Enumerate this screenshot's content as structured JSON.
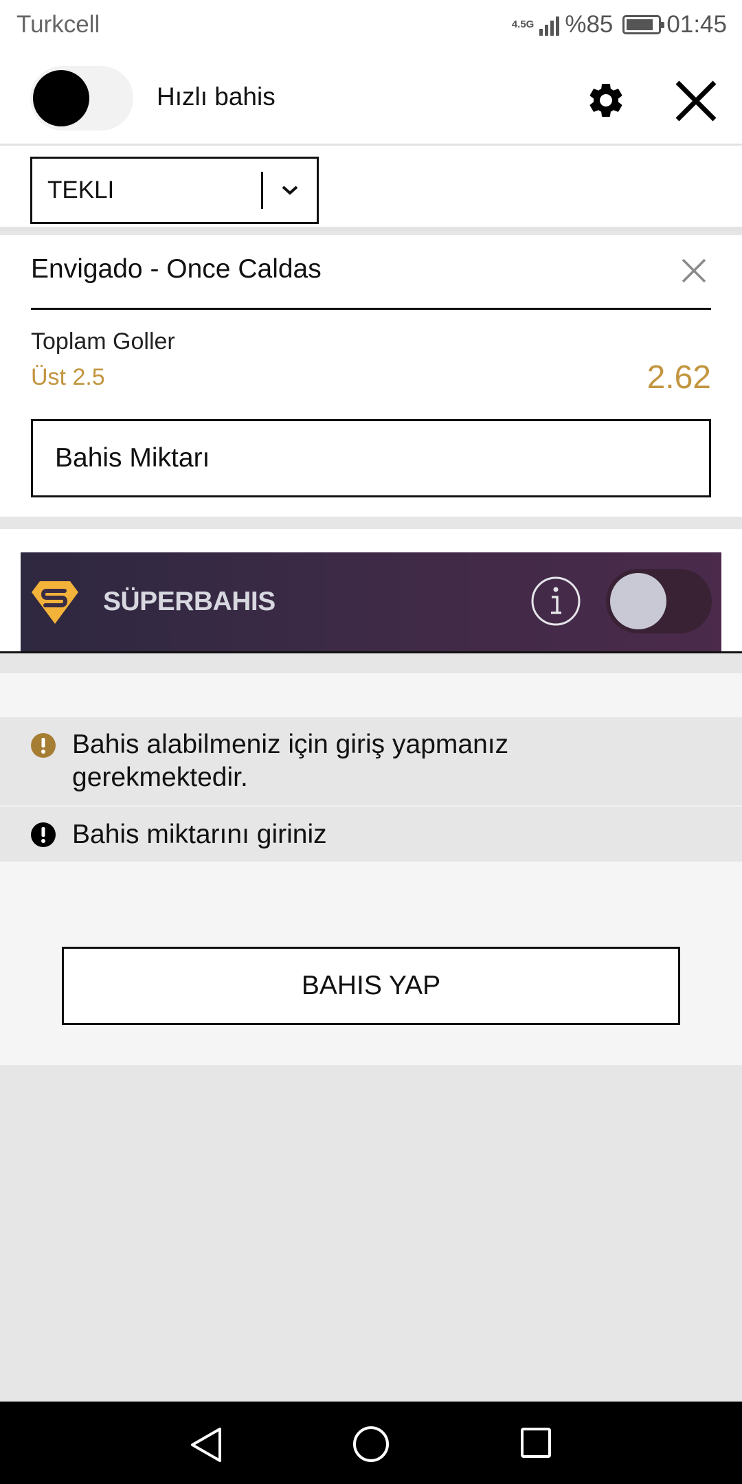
{
  "status_bar": {
    "carrier": "Turkcell",
    "network": "4.5G",
    "battery_text": "%85",
    "battery_level": 0.85,
    "time": "01:45"
  },
  "header": {
    "quick_bet_label": "Hızlı bahis",
    "quick_bet_enabled": false,
    "icons": [
      "gear-icon",
      "close-icon"
    ]
  },
  "bet_type": {
    "selected": "TEKLI"
  },
  "bet": {
    "match": "Envigado - Once Caldas",
    "market": "Toplam Goller",
    "selection": "Üst 2.5",
    "odds": "2.62",
    "stake_placeholder": "Bahis Miktarı"
  },
  "superbahis": {
    "title": "SÜPERBAHIS",
    "enabled": false
  },
  "messages": [
    {
      "icon": "warning-icon",
      "text": "Bahis alabilmeniz için giriş yapmanız gerekmektedir."
    },
    {
      "icon": "error-icon",
      "text": "Bahis miktarını giriniz"
    }
  ],
  "place_bet_label": "BAHIS YAP",
  "colors": {
    "accent_gold": "#c2953f",
    "superbahis_bg": "#3f2a47",
    "superbahis_logo": "#f3b23a"
  }
}
